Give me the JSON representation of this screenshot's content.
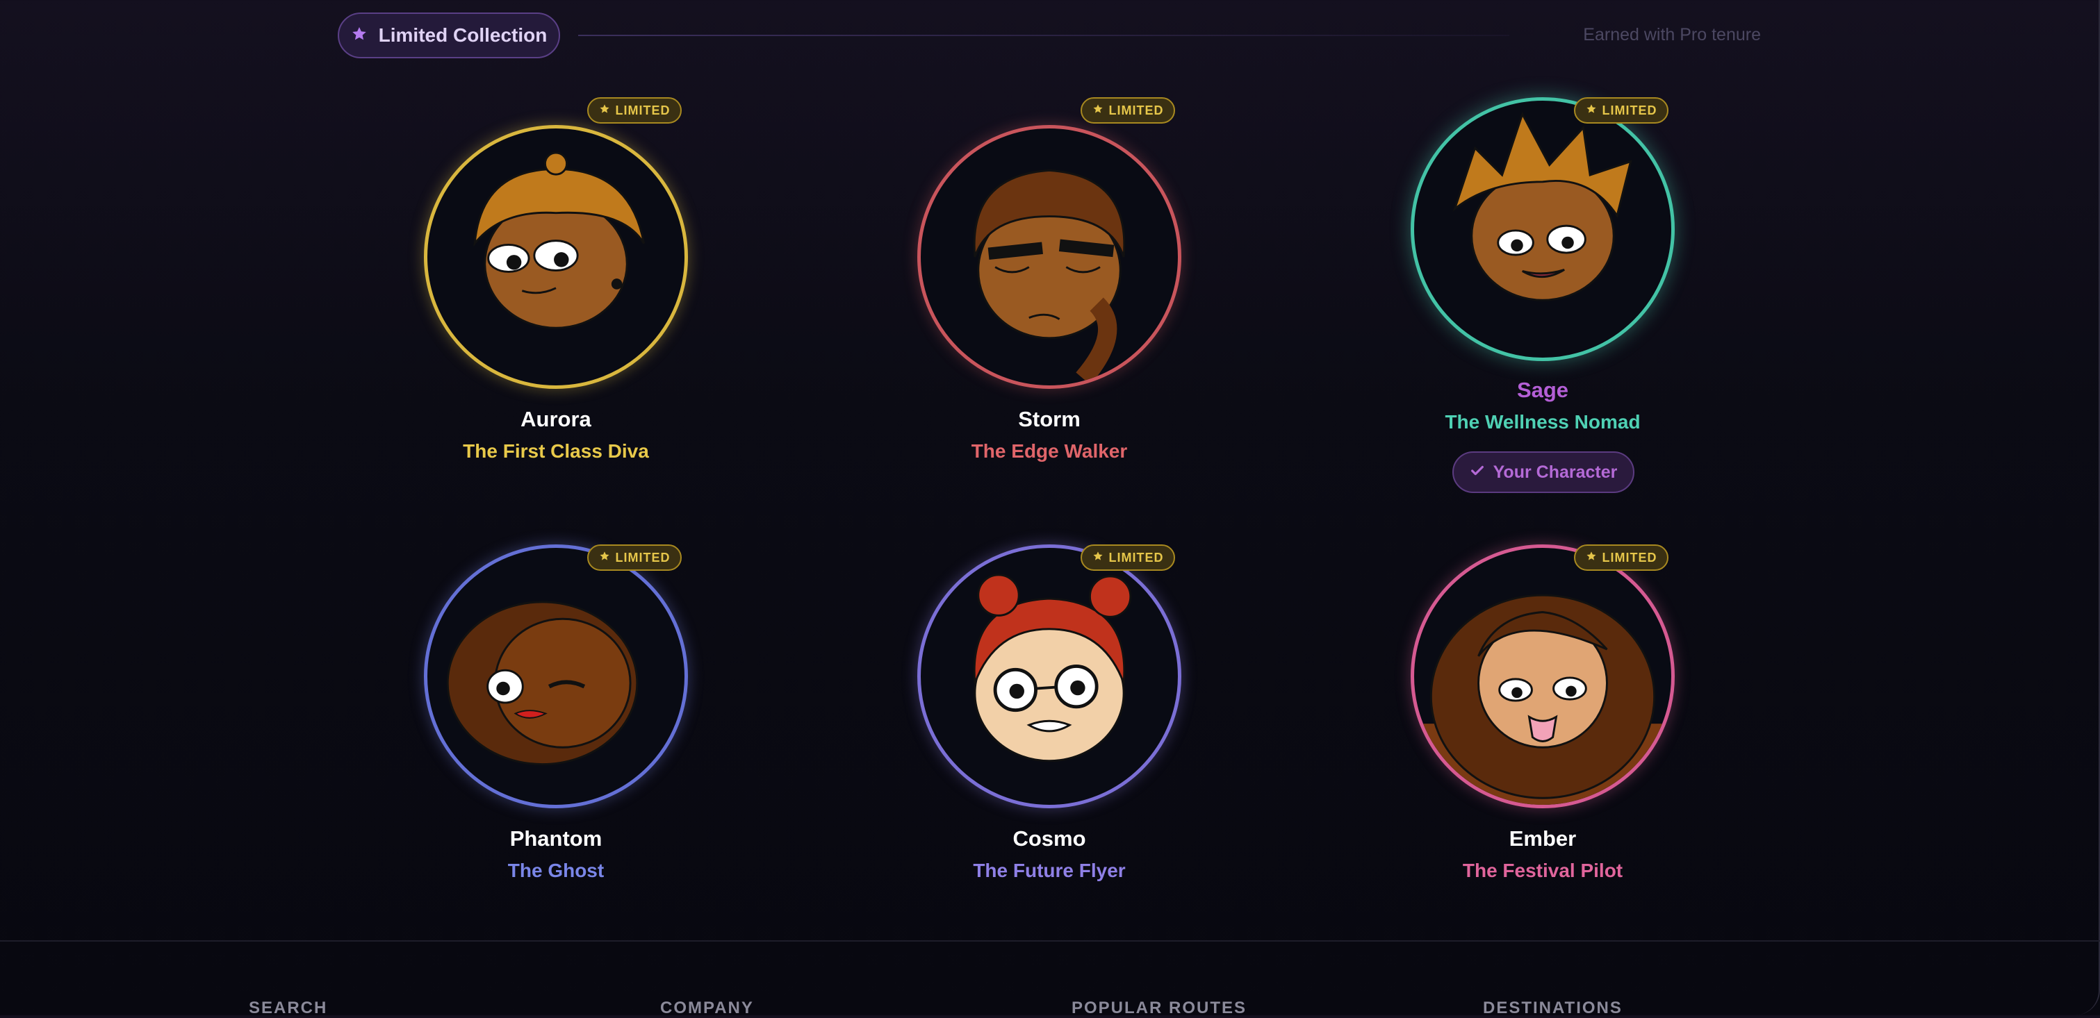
{
  "section": {
    "title": "Limited Collection",
    "note": "Earned with Pro tenure"
  },
  "badge_label": "LIMITED",
  "your_character_label": "Your Character",
  "characters": [
    {
      "name": "Aurora",
      "title": "The First Class Diva",
      "accent": "#e8c94a",
      "selected": false
    },
    {
      "name": "Storm",
      "title": "The Edge Walker",
      "accent": "#e0656a",
      "selected": false
    },
    {
      "name": "Sage",
      "title": "The Wellness Nomad",
      "accent": "#4fd1b4",
      "name_color": "#b45fd6",
      "selected": true
    },
    {
      "name": "Phantom",
      "title": "The Ghost",
      "accent": "#7a86e8",
      "selected": false
    },
    {
      "name": "Cosmo",
      "title": "The Future Flyer",
      "accent": "#8f80e6",
      "selected": false
    },
    {
      "name": "Ember",
      "title": "The Festival Pilot",
      "accent": "#e0659c",
      "selected": false
    }
  ],
  "footer": {
    "columns": [
      "SEARCH",
      "COMPANY",
      "POPULAR ROUTES",
      "DESTINATIONS"
    ]
  }
}
